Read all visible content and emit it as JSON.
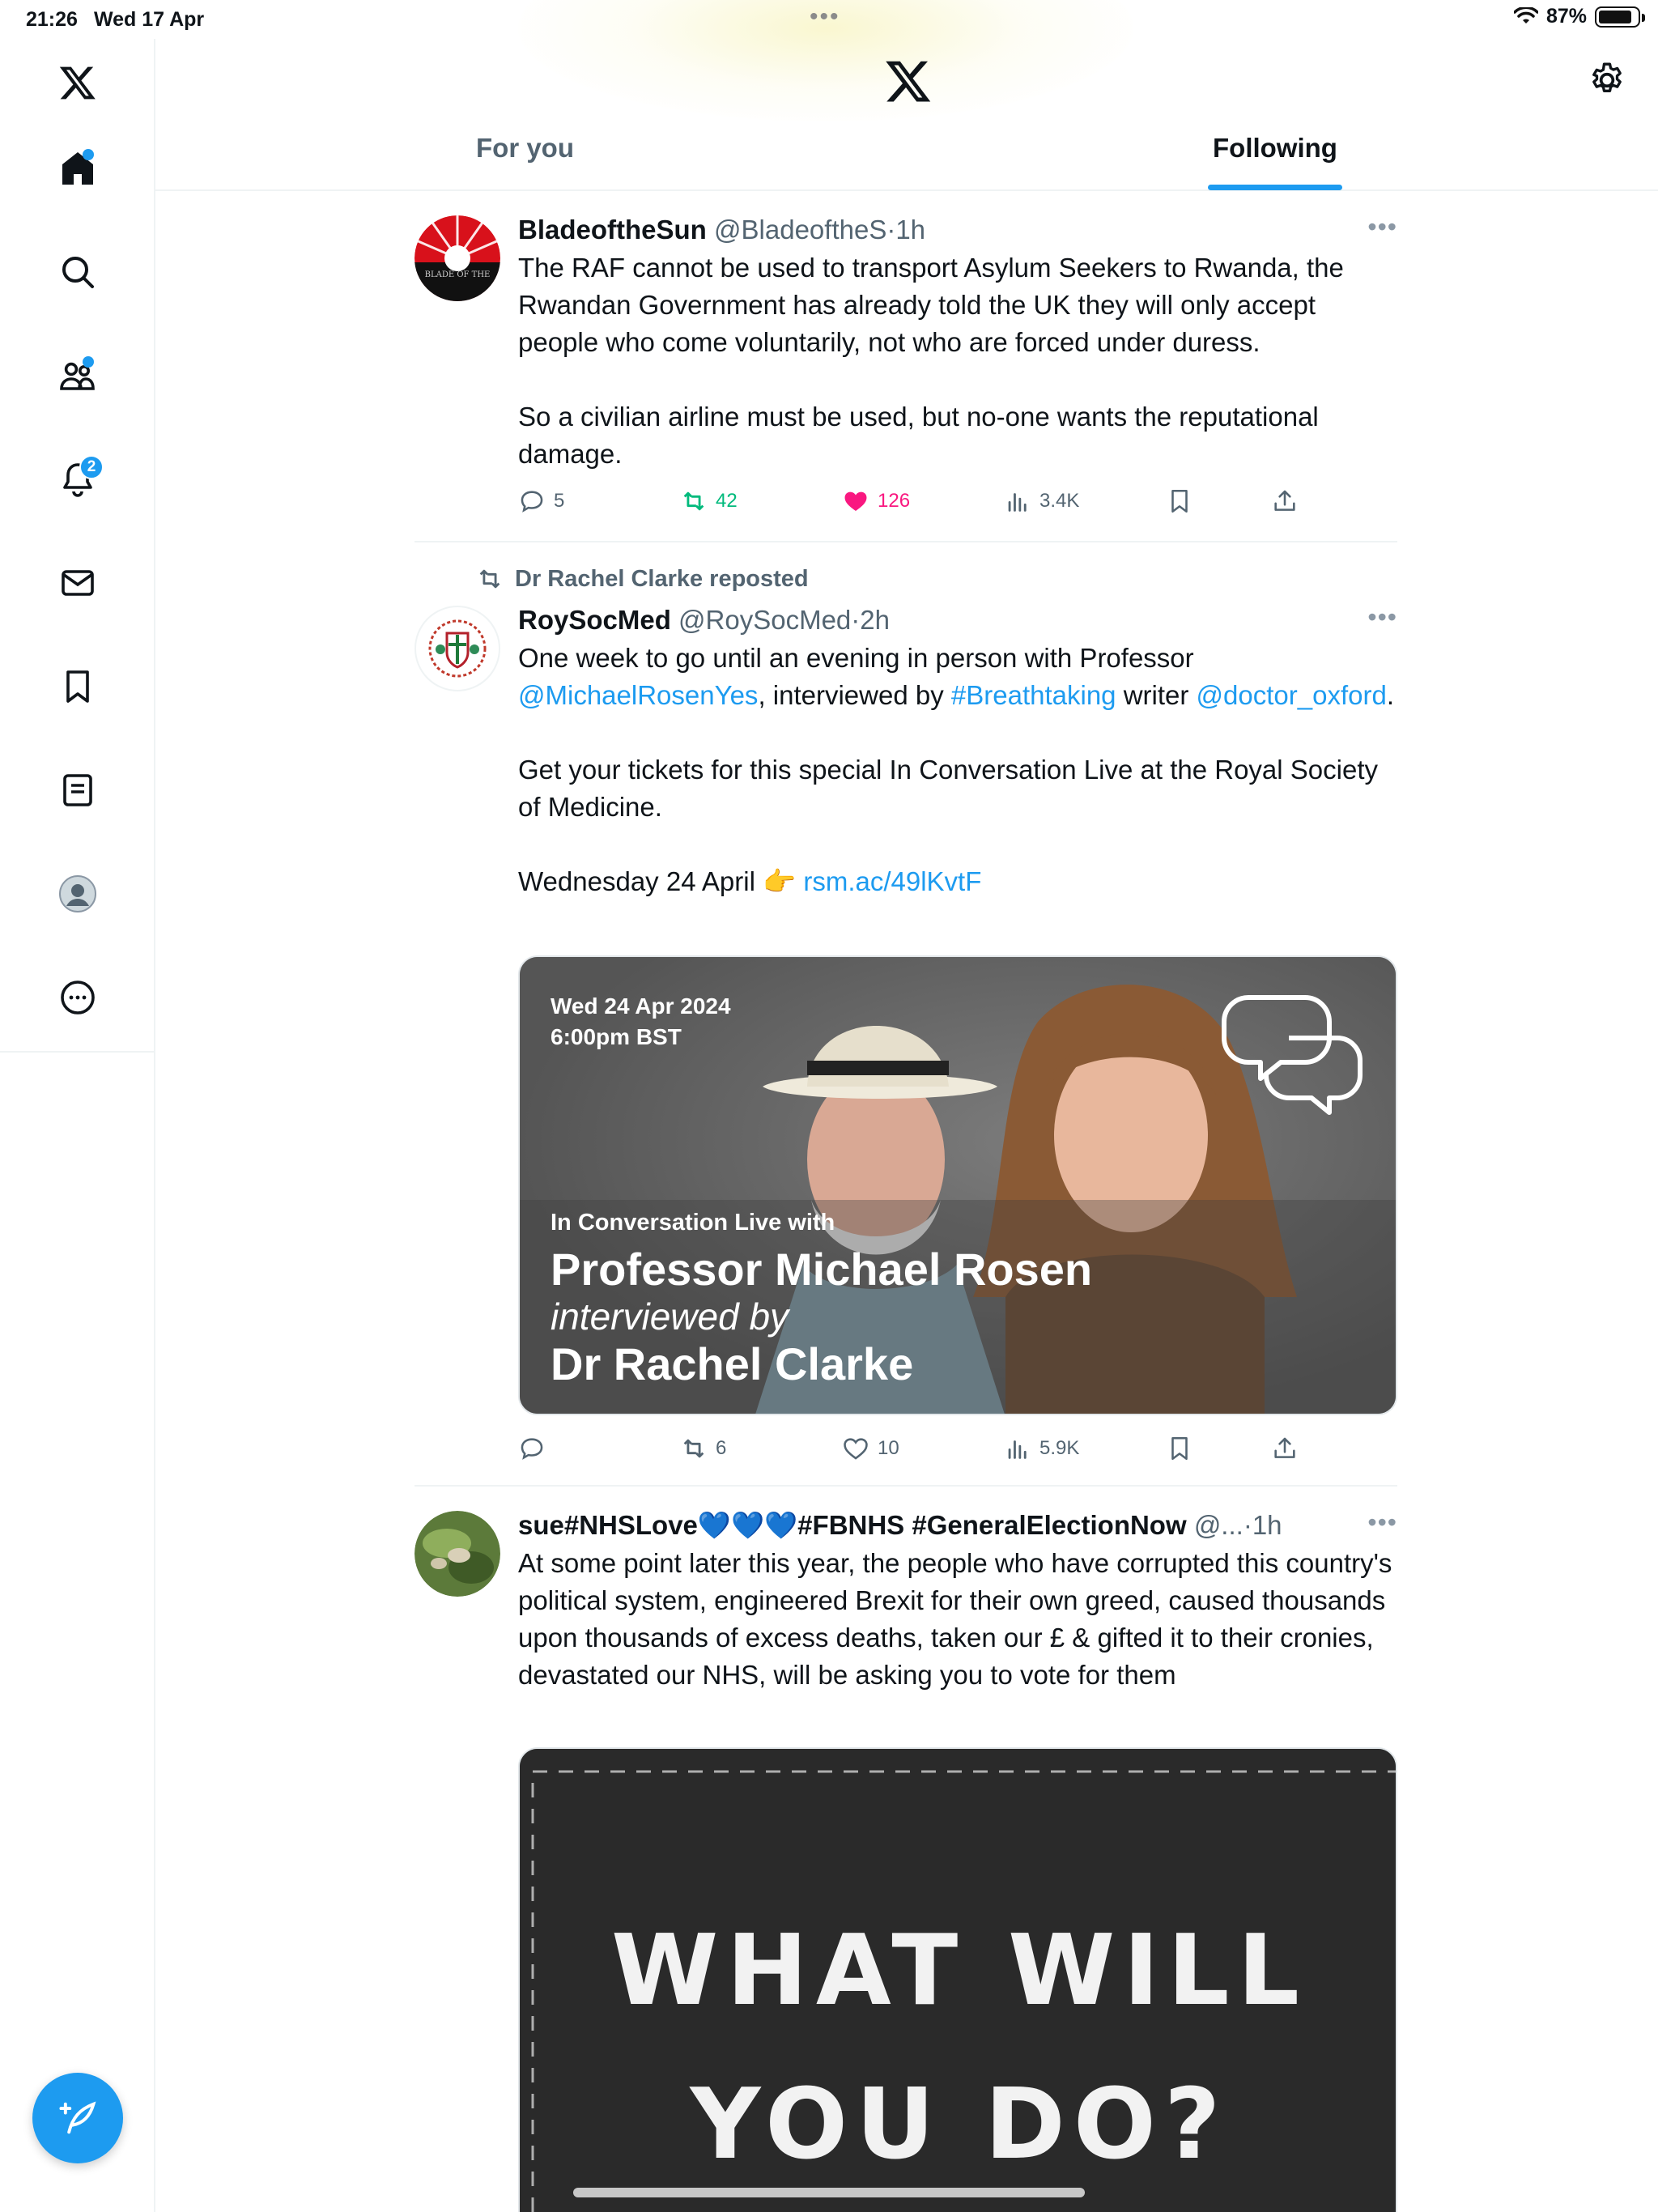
{
  "status": {
    "time": "21:26",
    "date": "Wed 17 Apr",
    "battery": "87%",
    "battery_level": 0.87
  },
  "nav": {
    "notifications_count": "2"
  },
  "tabs": {
    "for_you": "For you",
    "following": "Following"
  },
  "colors": {
    "accent": "#1d9bf0",
    "like": "#f91880",
    "repost": "#00ba7c"
  },
  "tweets": [
    {
      "name": "BladeoftheSun",
      "handle": "@BladeoftheS",
      "sep": "·",
      "time": "1h",
      "text": "The RAF cannot be used to transport Asylum Seekers to Rwanda, the Rwandan Government has already told the UK they will only accept people who come voluntarily, not who are forced under duress.\n\nSo a civilian airline must be used, but no-one wants the reputational damage.",
      "avatar_text": "BLADE OF THE",
      "replies": "5",
      "reposts": "42",
      "likes": "126",
      "views": "3.4K"
    },
    {
      "repost_label": "Dr Rachel Clarke reposted",
      "name": "RoySocMed",
      "handle": "@RoySocMed",
      "sep": "·",
      "time": "2h",
      "text_1": "One week to go until an evening in person with Professor ",
      "mention_1": "@MichaelRosenYes",
      "text_2": ", interviewed by ",
      "hashtag": "#Breathtaking",
      "text_3": " writer ",
      "mention_2": "@doctor_oxford",
      "text_4": ".\n\nGet your tickets for this special In Conversation Live at the Royal Society of Medicine.\n\nWednesday 24 April 👉 ",
      "link": "rsm.ac/49lKvtF",
      "media": {
        "date": "Wed 24 Apr 2024",
        "time": "6:00pm BST",
        "kicker": "In Conversation Live with",
        "headline": "Professor Michael Rosen",
        "sub": "interviewed by",
        "headline2": "Dr Rachel Clarke"
      },
      "replies": "",
      "reposts": "6",
      "likes": "10",
      "views": "5.9K"
    },
    {
      "name": "sue#NHSLove💙💙💙#FBNHS #GeneralElectionNow",
      "handle": "@...",
      "sep": "·",
      "time": "1h",
      "text": "At some point later this year, the people who have corrupted this country's political system, engineered Brexit for their own greed, caused thousands upon thousands of excess deaths, taken our £ & gifted it to their cronies, devastated our NHS, will be asking you to vote for them",
      "media": {
        "line1": "WHAT WILL",
        "line2": "YOU DO?"
      }
    }
  ]
}
